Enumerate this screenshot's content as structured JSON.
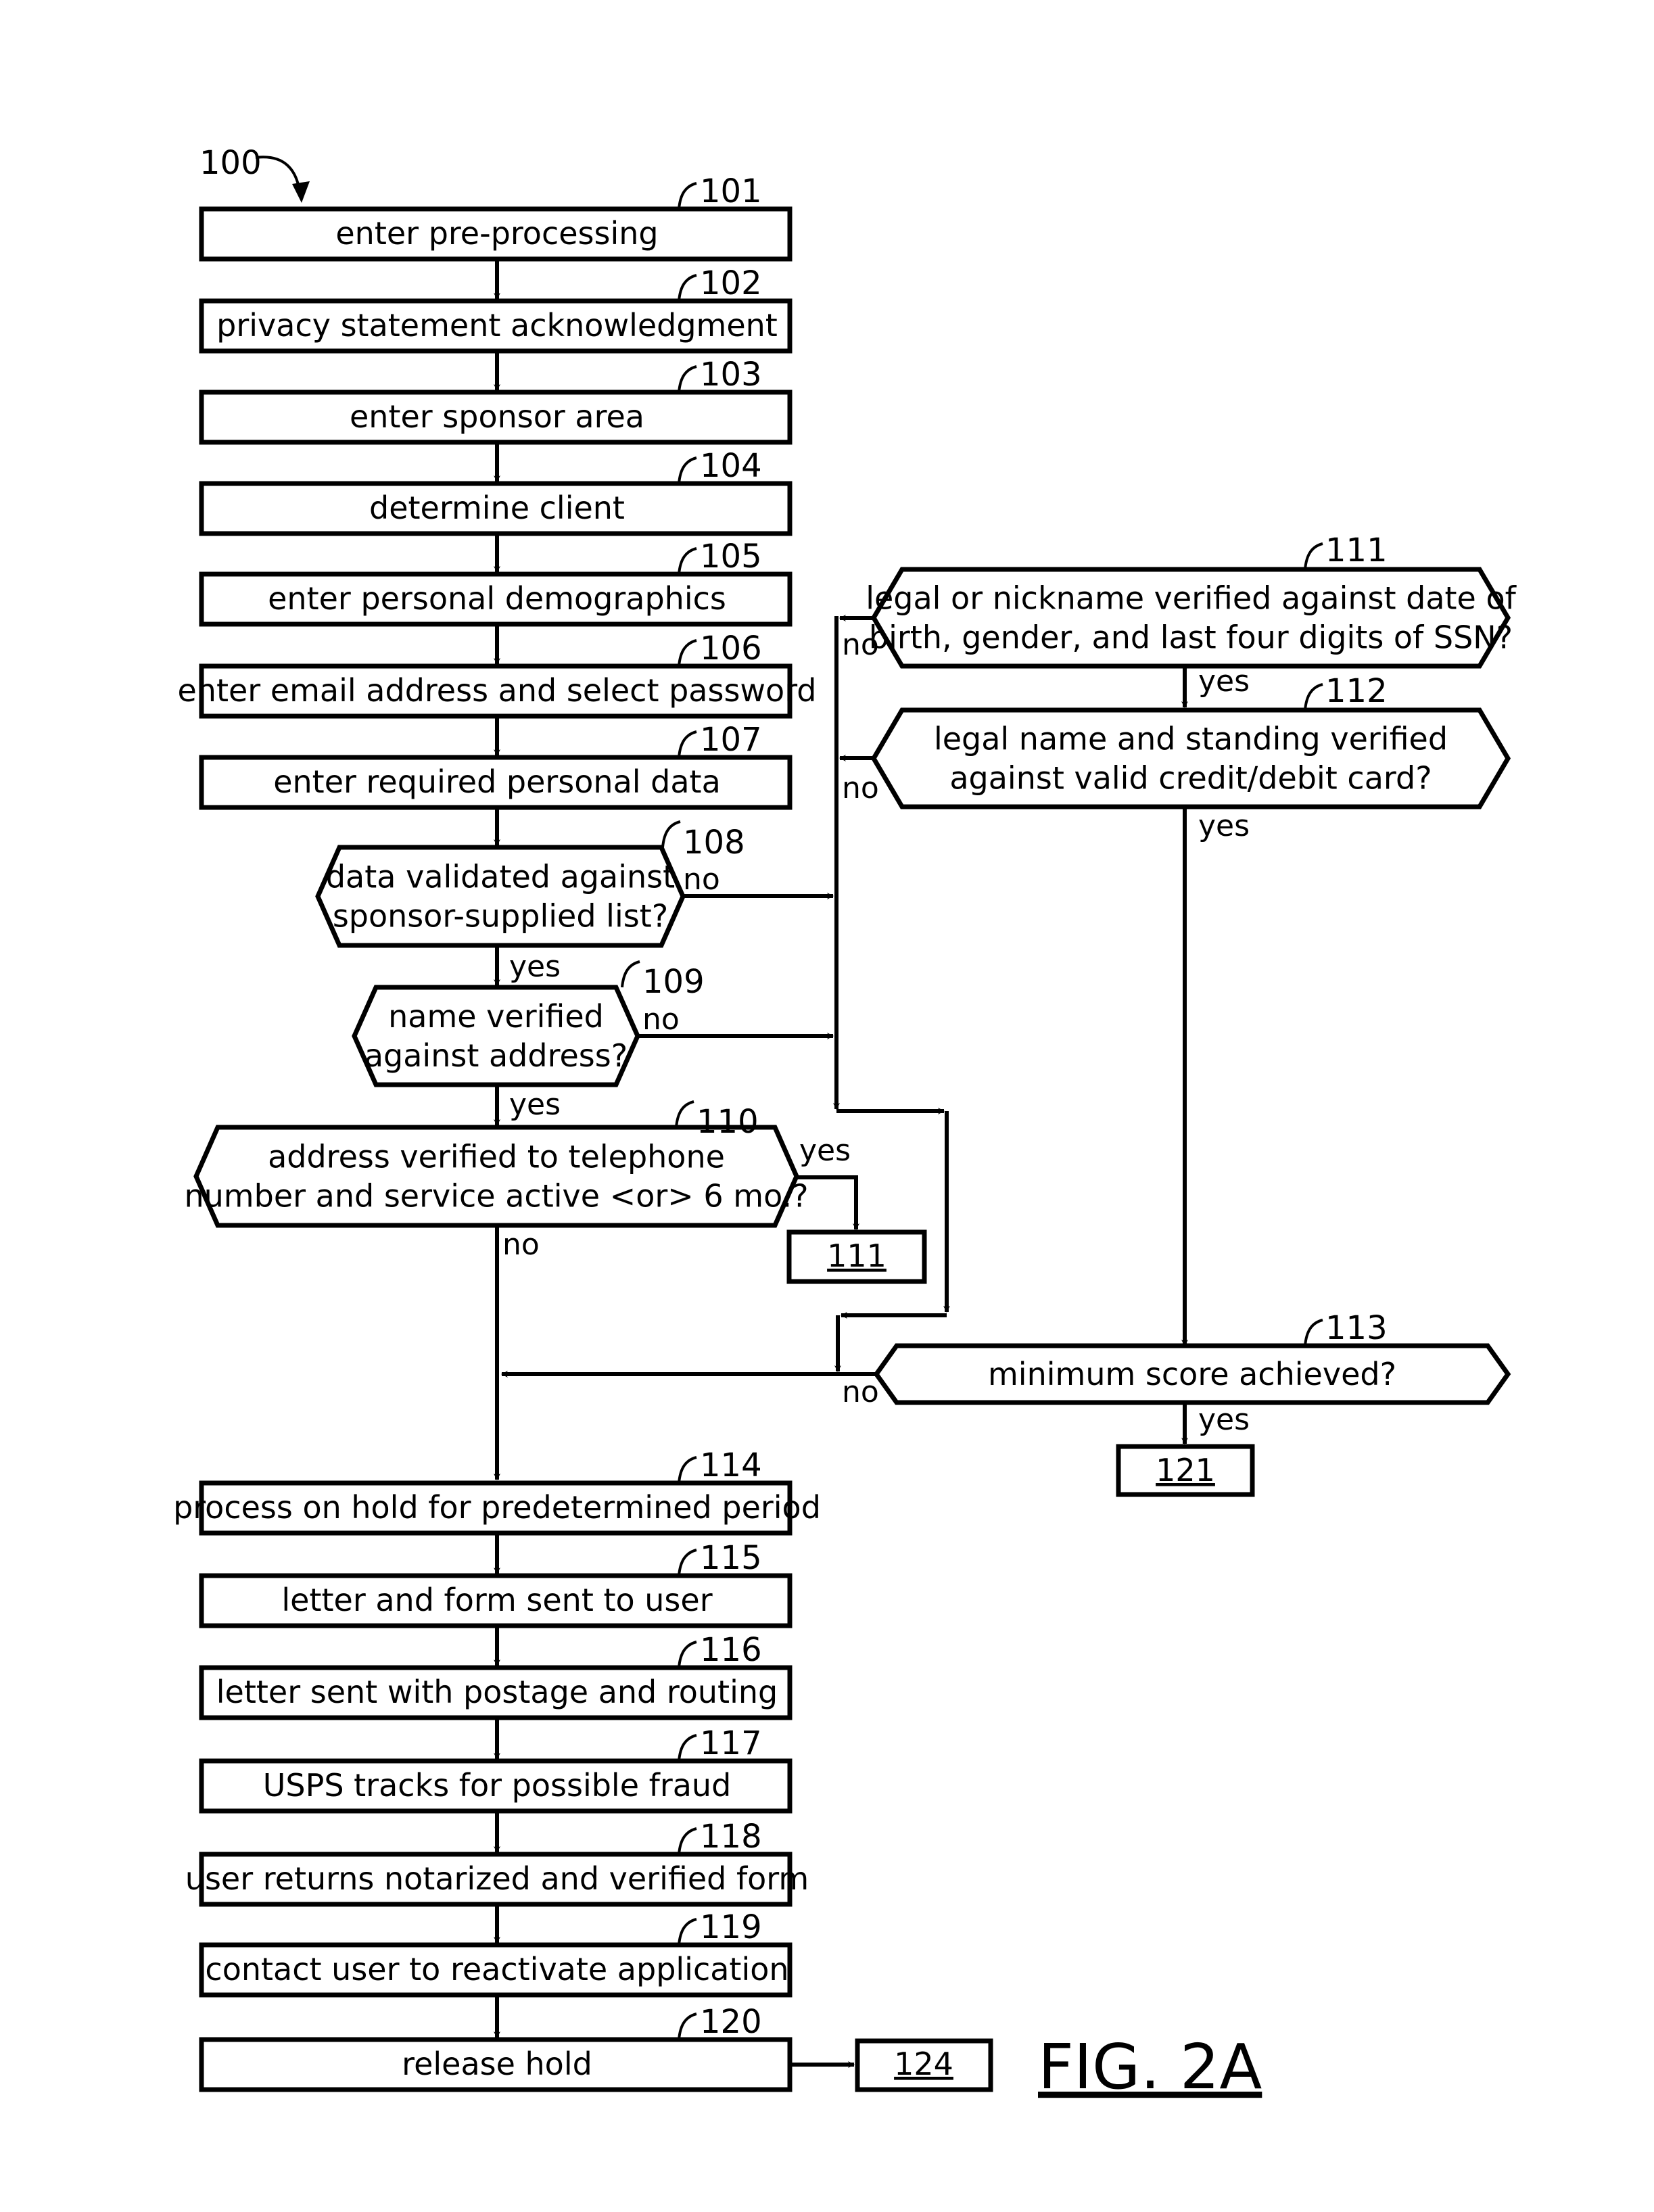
{
  "figure": {
    "label": "FIG. 2A",
    "reference": "100"
  },
  "steps": [
    {
      "ref": "101",
      "text": "enter pre-processing"
    },
    {
      "ref": "102",
      "text": "privacy statement acknowledgment"
    },
    {
      "ref": "103",
      "text": "enter sponsor area"
    },
    {
      "ref": "104",
      "text": "determine client"
    },
    {
      "ref": "105",
      "text": "enter personal demographics"
    },
    {
      "ref": "106",
      "text": "enter email address and select password"
    },
    {
      "ref": "107",
      "text": "enter required personal data"
    }
  ],
  "decisions": {
    "d108": {
      "ref": "108",
      "lines": [
        "data validated against",
        "sponsor-supplied list?"
      ],
      "yes": "yes",
      "no": "no"
    },
    "d109": {
      "ref": "109",
      "lines": [
        "name verified",
        "against address?"
      ],
      "yes": "yes",
      "no": "no"
    },
    "d110": {
      "ref": "110",
      "lines": [
        "address verified to telephone",
        "number and service active <or> 6 mo.?"
      ],
      "yes": "yes",
      "no": "no"
    },
    "d111": {
      "ref": "111",
      "lines": [
        "legal or nickname verified against date of",
        "birth, gender, and last four digits of SSN?"
      ],
      "yes": "yes",
      "no": "no"
    },
    "d112": {
      "ref": "112",
      "lines": [
        "legal name and standing verified",
        "against valid credit/debit card?"
      ],
      "yes": "yes",
      "no": "no"
    },
    "d113": {
      "ref": "113",
      "lines": [
        "minimum score achieved?"
      ],
      "yes": "yes",
      "no": "no"
    }
  },
  "hold_steps": [
    {
      "ref": "114",
      "text": "process on hold for predetermined period"
    },
    {
      "ref": "115",
      "text": "letter and form sent to user"
    },
    {
      "ref": "116",
      "text": "letter sent with postage and routing"
    },
    {
      "ref": "117",
      "text": "USPS tracks for possible fraud"
    },
    {
      "ref": "118",
      "text": "user returns notarized and verified form"
    },
    {
      "ref": "119",
      "text": "contact user to reactivate application"
    },
    {
      "ref": "120",
      "text": "release hold"
    }
  ],
  "connectors": {
    "to_111": "111",
    "to_121": "121",
    "to_124": "124"
  }
}
